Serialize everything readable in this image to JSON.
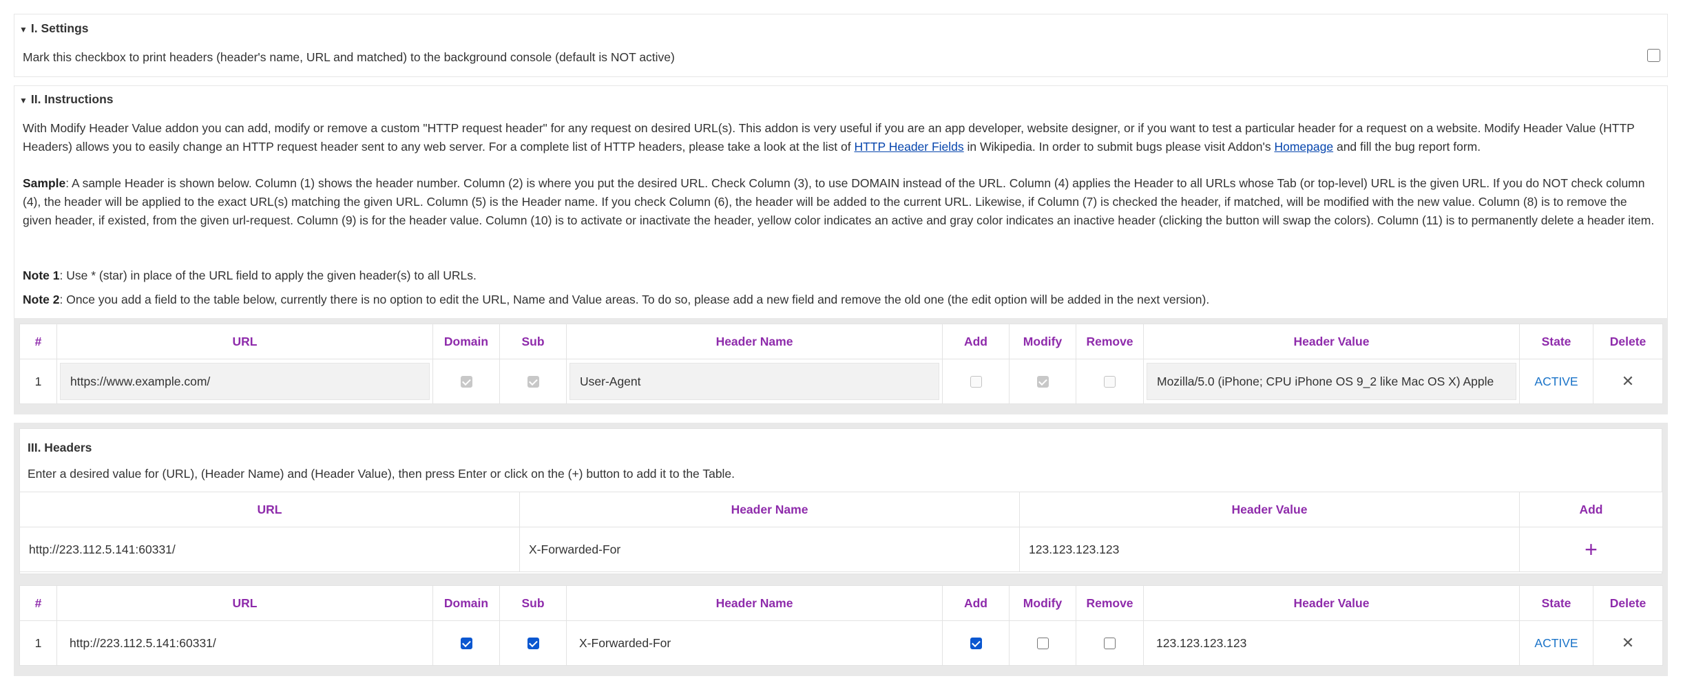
{
  "settings": {
    "title": "I. Settings",
    "text": "Mark this checkbox to print headers (header's name, URL and matched) to the background console (default is NOT active)",
    "checked": false
  },
  "instructions": {
    "title": "II. Instructions",
    "p1_a": "With Modify Header Value addon you can add, modify or remove a custom \"HTTP request header\" for any request on desired URL(s). This addon is very useful if you are an app developer, website designer, or if you want to test a particular header for a request on a website. Modify Header Value (HTTP Headers) allows you to easily change an HTTP request header sent to any web server. For a complete list of HTTP headers, please take a look at the list of ",
    "p1_link1": "HTTP Header Fields",
    "p1_b": " in Wikipedia. In order to submit bugs please visit Addon's ",
    "p1_link2": "Homepage",
    "p1_c": " and fill the bug report form.",
    "sample_label": "Sample",
    "sample_text": ": A sample Header is shown below. Column (1) shows the header number. Column (2) is where you put the desired URL. Check Column (3), to use DOMAIN instead of the URL. Column (4) applies the Header to all URLs whose Tab (or top-level) URL is the given URL. If you do NOT check column (4), the header will be applied to the exact URL(s) matching the given URL. Column (5) is the Header name. If you check Column (6), the header will be added to the current URL. Likewise, if Column (7) is checked the header, if matched, will be modified with the new value. Column (8) is to remove the given header, if existed, from the given url-request. Column (9) is for the header value. Column (10) is to activate or inactivate the header, yellow color indicates an active and gray color indicates an inactive header (clicking the button will swap the colors). Column (11) is to permanently delete a header item.",
    "note1_label": "Note 1",
    "note1_text": ": Use * (star) in place of the URL field to apply the given header(s) to all URLs.",
    "note2_label": "Note 2",
    "note2_text": ": Once you add a field to the table below, currently there is no option to edit the URL, Name and Value areas. To do so, please add a new field and remove the old one (the edit option will be added in the next version)."
  },
  "columns": {
    "num": "#",
    "url": "URL",
    "domain": "Domain",
    "sub": "Sub",
    "name": "Header Name",
    "add": "Add",
    "modify": "Modify",
    "remove": "Remove",
    "value": "Header Value",
    "state": "State",
    "delete": "Delete"
  },
  "sample_row": {
    "num": "1",
    "url": "https://www.example.com/",
    "domain": true,
    "sub": true,
    "name": "User-Agent",
    "add": false,
    "modify": true,
    "remove": false,
    "value": "Mozilla/5.0 (iPhone; CPU iPhone OS 9_2 like Mac OS X) Apple",
    "state": "ACTIVE",
    "delete_icon": "close-icon",
    "delete_glyph": "✕"
  },
  "headers": {
    "title": "III. Headers",
    "text": "Enter a desired value for (URL), (Header Name) and (Header Value), then press Enter or click on the (+) button to add it to the Table.",
    "input_url": "http://223.112.5.141:60331/",
    "input_name": "X-Forwarded-For",
    "input_value": "123.123.123.123",
    "add_glyph": "+",
    "add_icon": "plus-icon"
  },
  "rows": [
    {
      "num": "1",
      "url": "http://223.112.5.141:60331/",
      "domain": true,
      "sub": true,
      "name": "X-Forwarded-For",
      "add": true,
      "modify": false,
      "remove": false,
      "value": "123.123.123.123",
      "state": "ACTIVE",
      "delete_glyph": "✕"
    }
  ],
  "colors": {
    "header_text": "#8e2bab",
    "state": "#1a73c8",
    "checkbox": "#0b57d0",
    "link": "#0645ad"
  }
}
